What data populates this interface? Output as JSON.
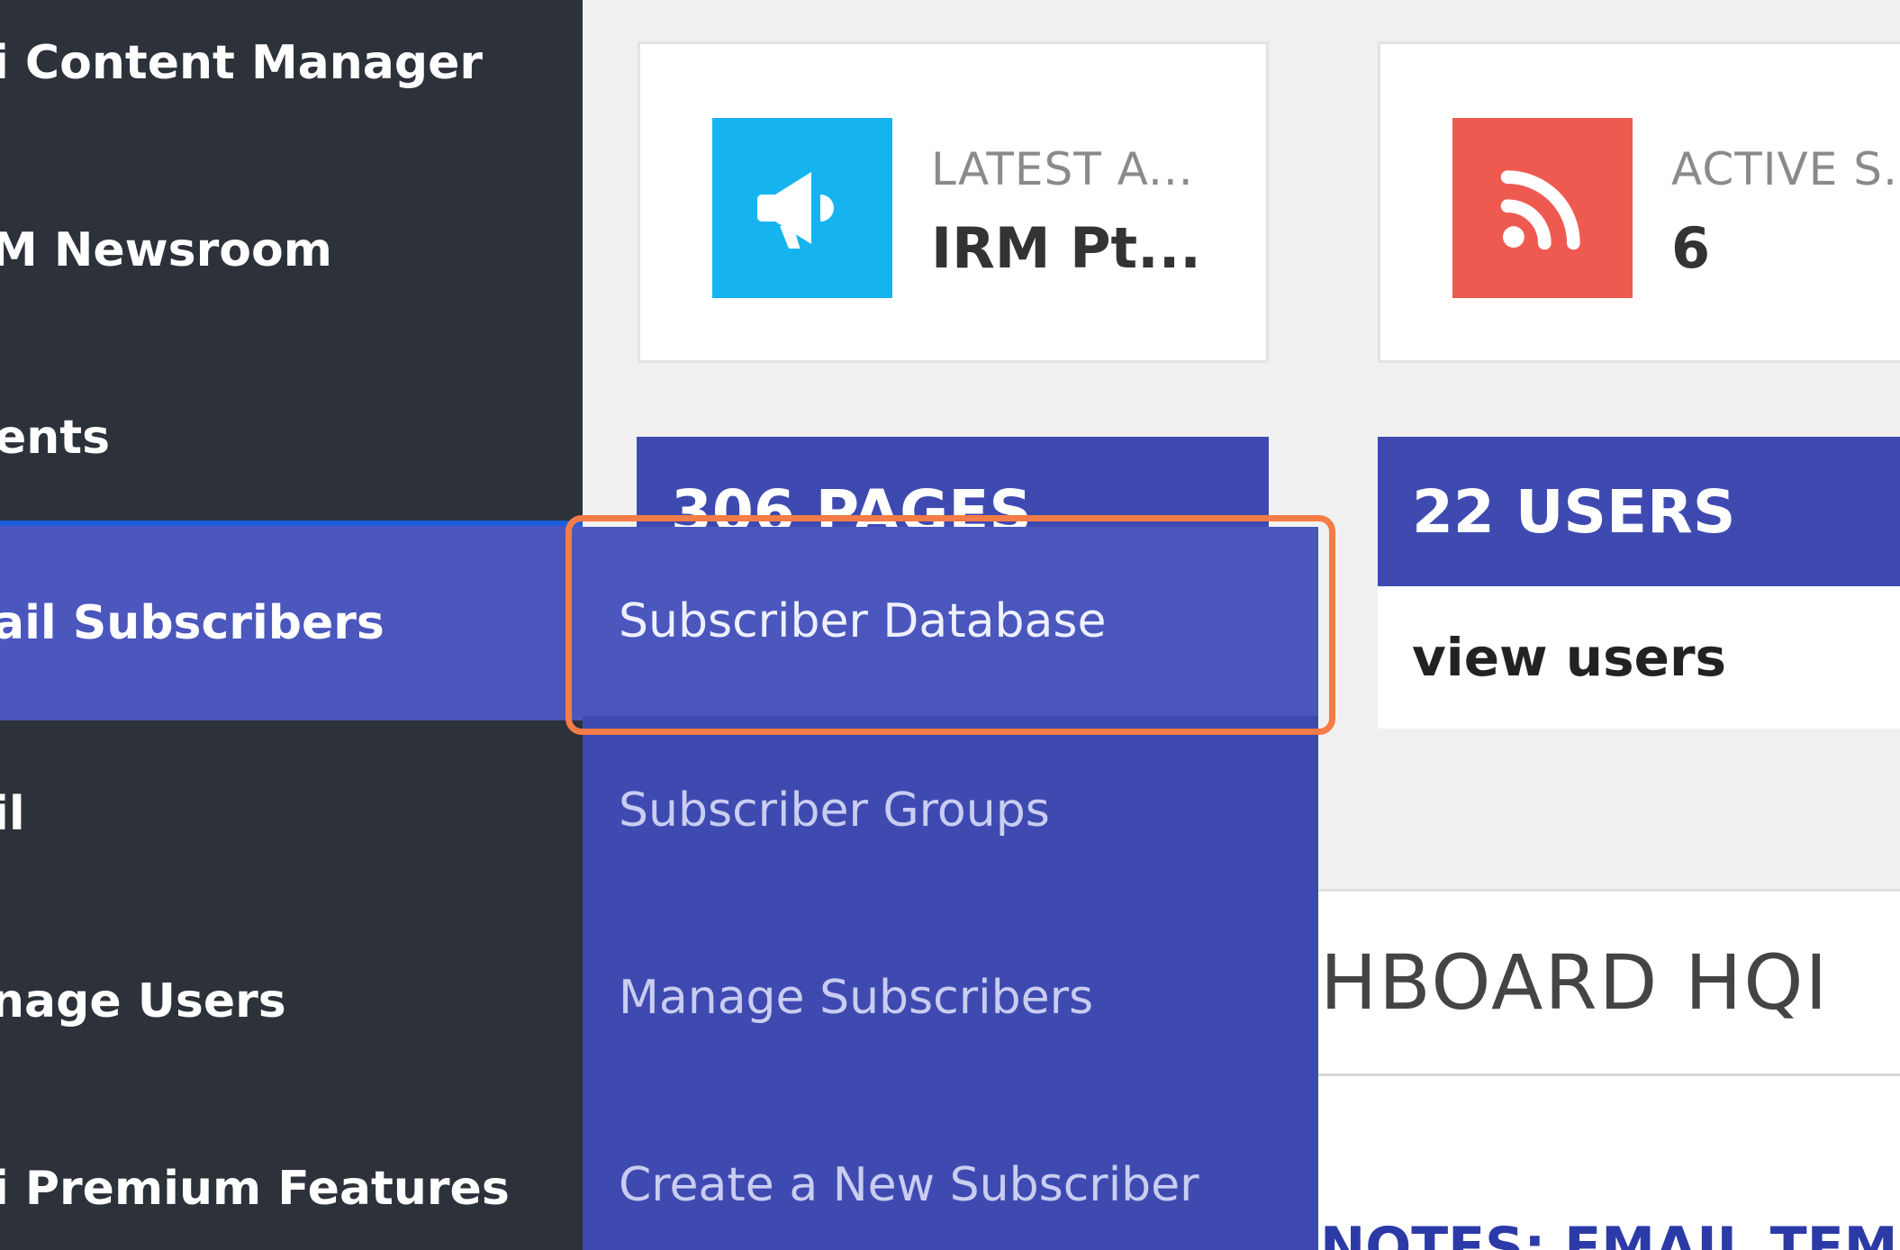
{
  "sidebar": {
    "items": [
      {
        "label": "i Content Manager"
      },
      {
        "label": "M Newsroom"
      },
      {
        "label": "ents"
      },
      {
        "label": "ail Subscribers",
        "active": true
      },
      {
        "label": "il"
      },
      {
        "label": "nage Users"
      },
      {
        "label": "i Premium Features"
      }
    ]
  },
  "submenu": {
    "items": [
      {
        "label": "Subscriber Database",
        "active": true
      },
      {
        "label": "Subscriber Groups"
      },
      {
        "label": "Manage Subscribers"
      },
      {
        "label": "Create a New Subscriber"
      }
    ]
  },
  "cards": [
    {
      "label": "LATEST A...",
      "value": "IRM Pt...",
      "icon": "megaphone-icon",
      "color": "#16b4ee"
    },
    {
      "label": "ACTIVE S...",
      "value": "6",
      "icon": "rss-feed-icon",
      "color": "#ee5a50"
    }
  ],
  "counts": {
    "pages": "306 PAGES",
    "users": "22 USERS",
    "users_link": "view users"
  },
  "dashboard": {
    "title": "HBOARD HQI",
    "notes": "NOTES: EMAIL TEMPL"
  },
  "colors": {
    "sidebar_bg": "#2c313a",
    "accent": "#3f4ab1",
    "active": "#4b57bd",
    "highlight": "#f47c46"
  }
}
